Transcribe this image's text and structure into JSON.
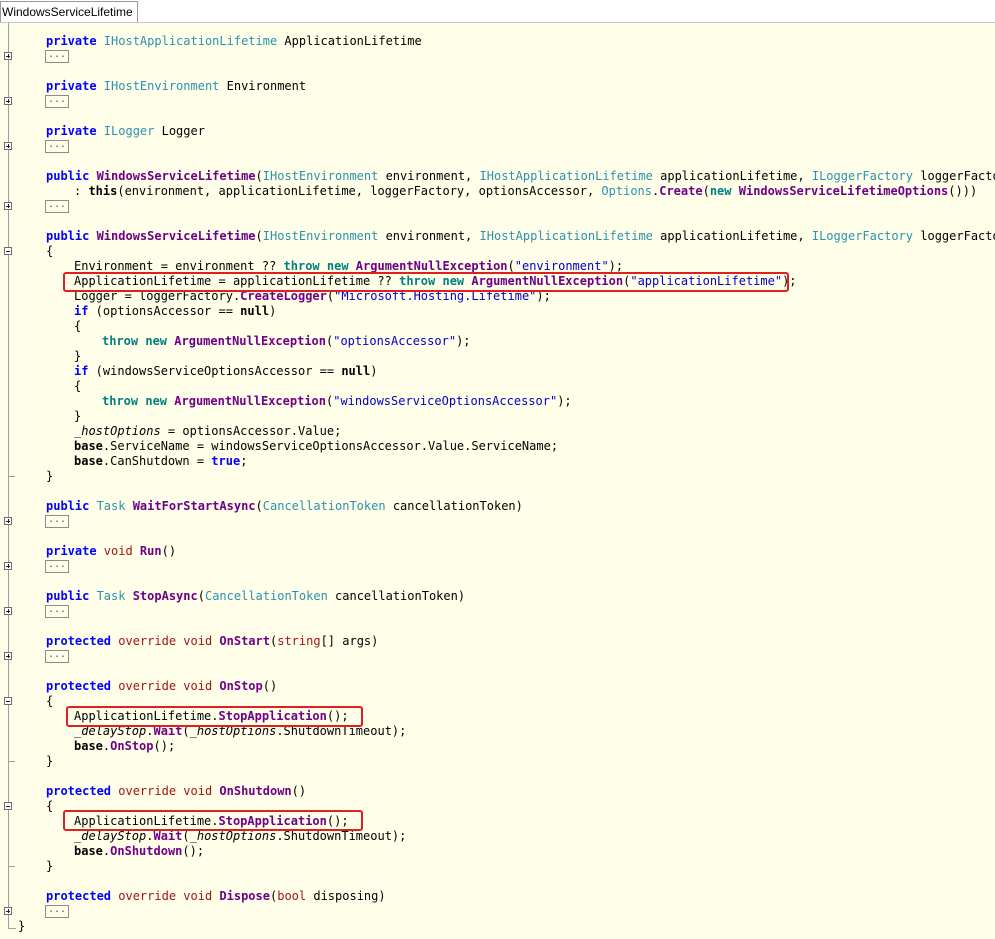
{
  "tab": {
    "title": "WindowsServiceLifetime"
  },
  "collapsed_marker": "...",
  "lines": {
    "l1": [
      "private",
      " IHostApplicationLifetime",
      " ApplicationLifetime"
    ],
    "l2": [
      "private",
      " IHostEnvironment",
      " Environment"
    ],
    "l3": [
      "private",
      " ILogger",
      " Logger"
    ],
    "l4a": [
      "public",
      " WindowsServiceLifetime",
      "(",
      "IHostEnvironment",
      " environment, ",
      "IHostApplicationLifetime",
      " applicationLifetime, ",
      "ILoggerFactory",
      " loggerFactory,"
    ],
    "l4b": [
      ": ",
      "this",
      "(environment, applicationLifetime, loggerFactory, optionsAccessor, ",
      "Options",
      ".",
      "Create",
      "(",
      "new",
      " ",
      "WindowsServiceLifetimeOptions",
      "()))"
    ],
    "l5": [
      "public",
      " WindowsServiceLifetime",
      "(",
      "IHostEnvironment",
      " environment, ",
      "IHostApplicationLifetime",
      " applicationLifetime, ",
      "ILoggerFactory",
      " loggerFactory,"
    ],
    "brace_open": "{",
    "brace_close": "}",
    "c1": [
      "Environment = environment ?? ",
      "throw",
      " ",
      "new",
      " ",
      "ArgumentNullException",
      "(",
      "\"environment\"",
      ");"
    ],
    "c2": [
      "ApplicationLifetime = applicationLifetime ?? ",
      "throw",
      " ",
      "new",
      " ",
      "ArgumentNullException",
      "(",
      "\"applicationLifetime\"",
      ");"
    ],
    "c3": [
      "Logger = loggerFactory.",
      "CreateLogger",
      "(",
      "\"Microsoft.Hosting.Lifetime\"",
      ");"
    ],
    "c4": [
      "if",
      " (optionsAccessor == ",
      "null",
      ")"
    ],
    "c5": [
      "throw",
      " ",
      "new",
      " ",
      "ArgumentNullException",
      "(",
      "\"optionsAccessor\"",
      ");"
    ],
    "c6": [
      "if",
      " (windowsServiceOptionsAccessor == ",
      "null",
      ")"
    ],
    "c7": [
      "throw",
      " ",
      "new",
      " ",
      "ArgumentNullException",
      "(",
      "\"windowsServiceOptionsAccessor\"",
      ");"
    ],
    "c8": [
      "_hostOptions",
      " = optionsAccessor.Value;"
    ],
    "c9": [
      "base",
      ".ServiceName = windowsServiceOptionsAccessor.Value.ServiceName;"
    ],
    "c10": [
      "base",
      ".CanShutdown = ",
      "true",
      ";"
    ],
    "m1": [
      "public",
      " Task",
      " WaitForStartAsync",
      "(",
      "CancellationToken",
      " cancellationToken)"
    ],
    "m2": [
      "private",
      " void",
      " Run",
      "()"
    ],
    "m3": [
      "public",
      " Task",
      " StopAsync",
      "(",
      "CancellationToken",
      " cancellationToken)"
    ],
    "m4": [
      "protected",
      " override",
      " void",
      " OnStart",
      "(",
      "string",
      "[] args)"
    ],
    "m5": [
      "protected",
      " override",
      " void",
      " OnStop",
      "()"
    ],
    "s1": [
      "ApplicationLifetime.",
      "StopApplication",
      "();"
    ],
    "s2": [
      "_delayStop",
      ".",
      "Wait",
      "(",
      "_hostOptions",
      ".ShutdownTimeout);"
    ],
    "s3": [
      "base",
      ".",
      "OnStop",
      "();"
    ],
    "m6": [
      "protected",
      " override",
      " void",
      " OnShutdown",
      "()"
    ],
    "t1": [
      "ApplicationLifetime.",
      "StopApplication",
      "();"
    ],
    "t2": [
      "_delayStop",
      ".",
      "Wait",
      "(",
      "_hostOptions",
      ".ShutdownTimeout);"
    ],
    "t3": [
      "base",
      ".",
      "OnShutdown",
      "();"
    ],
    "m7": [
      "protected",
      " override",
      " void",
      " Dispose",
      "(",
      "bool",
      " disposing)"
    ]
  },
  "colors": {
    "editor_bg": "#fffee8",
    "highlight_box": "#e02020",
    "keyword": "#0000ff",
    "type": "#2b91af",
    "string": "#0000c8"
  }
}
